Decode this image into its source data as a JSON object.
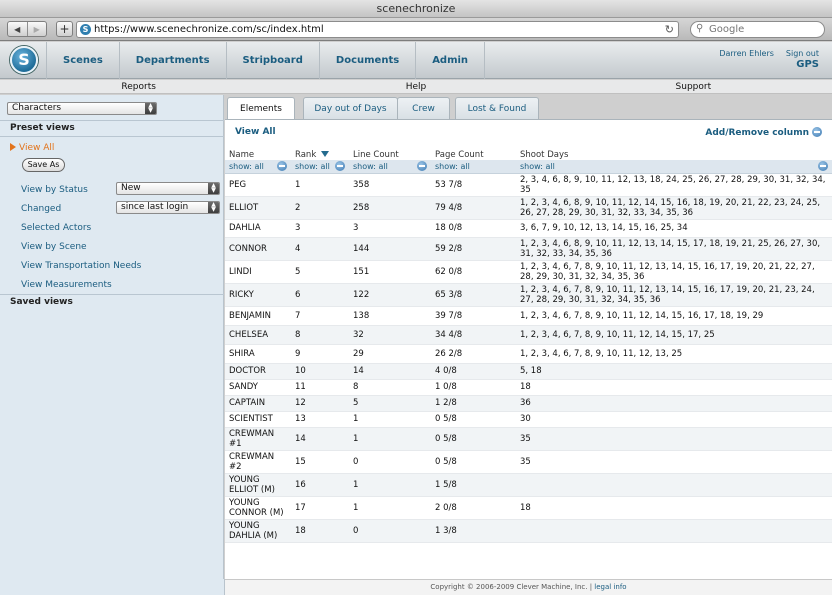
{
  "browser": {
    "window_title": "scenechronize",
    "url": "https://www.scenechronize.com/sc/index.html",
    "search_placeholder": "Google",
    "back_glyph": "◀",
    "forward_glyph": "▶",
    "plus_glyph": "+",
    "reload_glyph": "↻"
  },
  "app": {
    "logo_letter": "S",
    "nav": [
      "Scenes",
      "Departments",
      "Stripboard",
      "Documents",
      "Admin"
    ],
    "user_name": "Darren Ehlers",
    "sign_out": "Sign out",
    "project": "GPS",
    "subnav": [
      "Reports",
      "Help",
      "Support"
    ]
  },
  "sidebar": {
    "category_select": "Characters",
    "preset_views_label": "Preset views",
    "view_all": "View All",
    "save_as": "Save As",
    "view_by_status": "View by Status",
    "status_value": "New",
    "changed": "Changed",
    "changed_value": "since last login",
    "links": [
      "Selected Actors",
      "View by Scene",
      "View Transportation Needs",
      "View Measurements"
    ],
    "saved_views_label": "Saved views"
  },
  "tabs": [
    "Elements",
    "Day out of Days",
    "Crew",
    "Lost & Found"
  ],
  "content": {
    "view_all": "View All",
    "add_remove": "Add/Remove column",
    "columns": [
      "Name",
      "Rank",
      "Line Count",
      "Page Count",
      "Shoot Days"
    ],
    "show_label": "show: all",
    "rows": [
      [
        "PEG",
        "1",
        "358",
        "53 7/8",
        "2, 3, 4, 6, 8, 9, 10, 11, 12, 13, 18, 24, 25, 26, 27, 28, 29, 30, 31, 32, 34, 35"
      ],
      [
        "ELLIOT",
        "2",
        "258",
        "79 4/8",
        "1, 2, 3, 4, 6, 8, 9, 10, 11, 12, 14, 15, 16, 18, 19, 20, 21, 22, 23, 24, 25, 26, 27, 28, 29, 30, 31, 32, 33, 34, 35, 36"
      ],
      [
        "DAHLIA",
        "3",
        "3",
        "18 0/8",
        "3, 6, 7, 9, 10, 12, 13, 14, 15, 16, 25, 34"
      ],
      [
        "CONNOR",
        "4",
        "144",
        "59 2/8",
        "1, 2, 3, 4, 6, 8, 9, 10, 11, 12, 13, 14, 15, 17, 18, 19, 21, 25, 26, 27, 30, 31, 32, 33, 34, 35, 36"
      ],
      [
        "LINDI",
        "5",
        "151",
        "62 0/8",
        "1, 2, 3, 4, 6, 7, 8, 9, 10, 11, 12, 13, 14, 15, 16, 17, 19, 20, 21, 22, 27, 28, 29, 30, 31, 32, 34, 35, 36"
      ],
      [
        "RICKY",
        "6",
        "122",
        "65 3/8",
        "1, 2, 3, 4, 6, 7, 8, 9, 10, 11, 12, 13, 14, 15, 16, 17, 19, 20, 21, 23, 24, 27, 28, 29, 30, 31, 32, 34, 35, 36"
      ],
      [
        "BENJAMIN",
        "7",
        "138",
        "39 7/8",
        "1, 2, 3, 4, 6, 7, 8, 9, 10, 11, 12, 14, 15, 16, 17, 18, 19, 29"
      ],
      [
        "CHELSEA",
        "8",
        "32",
        "34 4/8",
        "1, 2, 3, 4, 6, 7, 8, 9, 10, 11, 12, 14, 15, 17, 25"
      ],
      [
        "SHIRA",
        "9",
        "29",
        "26 2/8",
        "1, 2, 3, 4, 6, 7, 8, 9, 10, 11, 12, 13, 25"
      ],
      [
        "DOCTOR",
        "10",
        "14",
        "4 0/8",
        "5, 18"
      ],
      [
        "SANDY",
        "11",
        "8",
        "1 0/8",
        "18"
      ],
      [
        "CAPTAIN",
        "12",
        "5",
        "1 2/8",
        "36"
      ],
      [
        "SCIENTIST",
        "13",
        "1",
        "0 5/8",
        "30"
      ],
      [
        "CREWMAN #1",
        "14",
        "1",
        "0 5/8",
        "35"
      ],
      [
        "CREWMAN #2",
        "15",
        "0",
        "0 5/8",
        "35"
      ],
      [
        "YOUNG ELLIOT (M)",
        "16",
        "1",
        "1 5/8",
        ""
      ],
      [
        "YOUNG CONNOR (M)",
        "17",
        "1",
        "2 0/8",
        "18"
      ],
      [
        "YOUNG DAHLIA (M)",
        "18",
        "0",
        "1 3/8",
        ""
      ]
    ]
  },
  "footer": {
    "copyright": "Copyright © 2006-2009 Clever Machine, Inc.",
    "divider": " | ",
    "legal": "legal info"
  },
  "colors": {
    "link_blue": "#1b5d80",
    "active_orange": "#e2731b",
    "sidebar_bg": "#dfe9f1"
  }
}
